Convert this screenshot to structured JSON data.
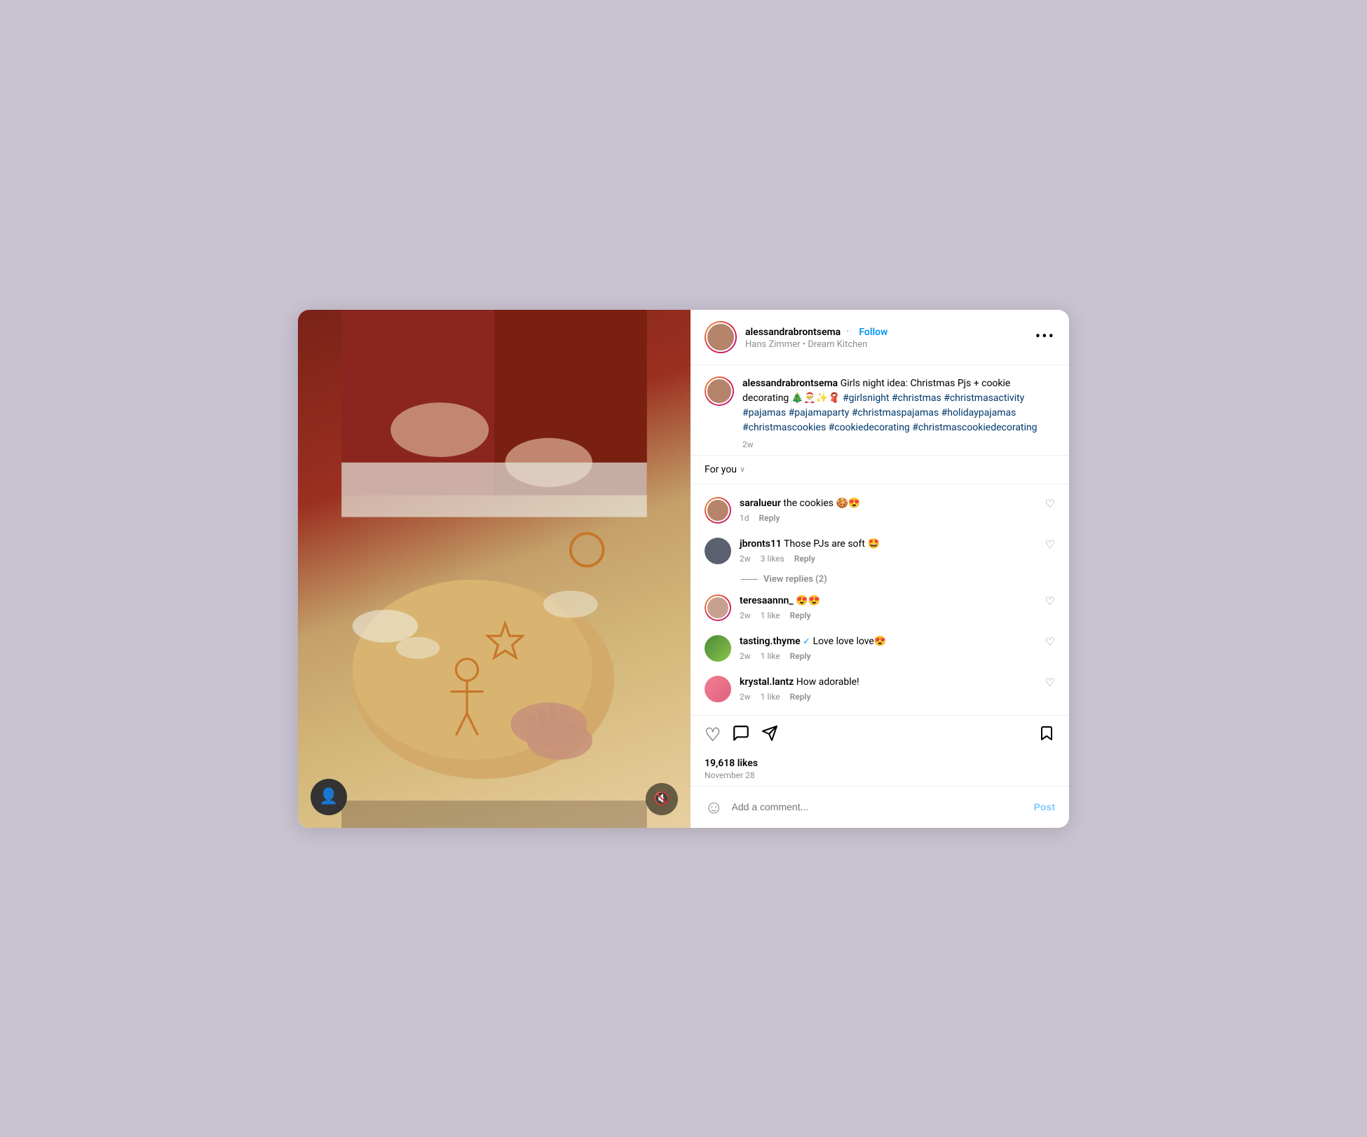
{
  "header": {
    "username": "alessandrabrontsema",
    "follow_label": "Follow",
    "dot": "·",
    "subtitle": "Hans Zimmer • Dream Kitchen",
    "more_icon": "···"
  },
  "caption": {
    "username": "alessandrabrontsema",
    "text": " Girls night idea: Christmas Pjs + cookie decorating 🎄🎅✨🧣 #girlsnight #christmas #christmasactivity #pajamas #pajamaparty #christmaspajamas #holidaypajamas #christmascookies #cookiedecorating #christmascookiedecorating",
    "time": "2w"
  },
  "for_you": {
    "label": "For you",
    "chevron": "∨"
  },
  "comments": [
    {
      "username": "saralueur",
      "text": " the cookies 🍪😍",
      "time": "1d",
      "likes": "",
      "reply_label": "Reply",
      "avatar_type": "gradient"
    },
    {
      "username": "jbronts11",
      "text": " Those PJs are soft 🤩",
      "time": "2w",
      "likes": "3 likes",
      "reply_label": "Reply",
      "avatar_type": "dark",
      "view_replies": "View replies (2)"
    },
    {
      "username": "teresaannn_",
      "text": " 😍😍",
      "time": "2w",
      "likes": "1 like",
      "reply_label": "Reply",
      "avatar_type": "gradient"
    },
    {
      "username": "tasting.thyme",
      "verified": true,
      "text": " Love love love😍",
      "time": "2w",
      "likes": "1 like",
      "reply_label": "Reply",
      "avatar_type": "nature"
    },
    {
      "username": "krystal.lantz",
      "text": " How adorable!",
      "time": "2w",
      "likes": "1 like",
      "reply_label": "Reply",
      "avatar_type": "pink"
    }
  ],
  "likes": {
    "count": "19,618 likes",
    "date": "November 28"
  },
  "add_comment": {
    "placeholder": "Add a comment...",
    "post_label": "Post"
  },
  "icons": {
    "heart": "♡",
    "comment": "💬",
    "share": "➤",
    "bookmark": "🔖",
    "emoji": "☺",
    "mute": "🔇",
    "user": "👤",
    "more": "•••"
  }
}
